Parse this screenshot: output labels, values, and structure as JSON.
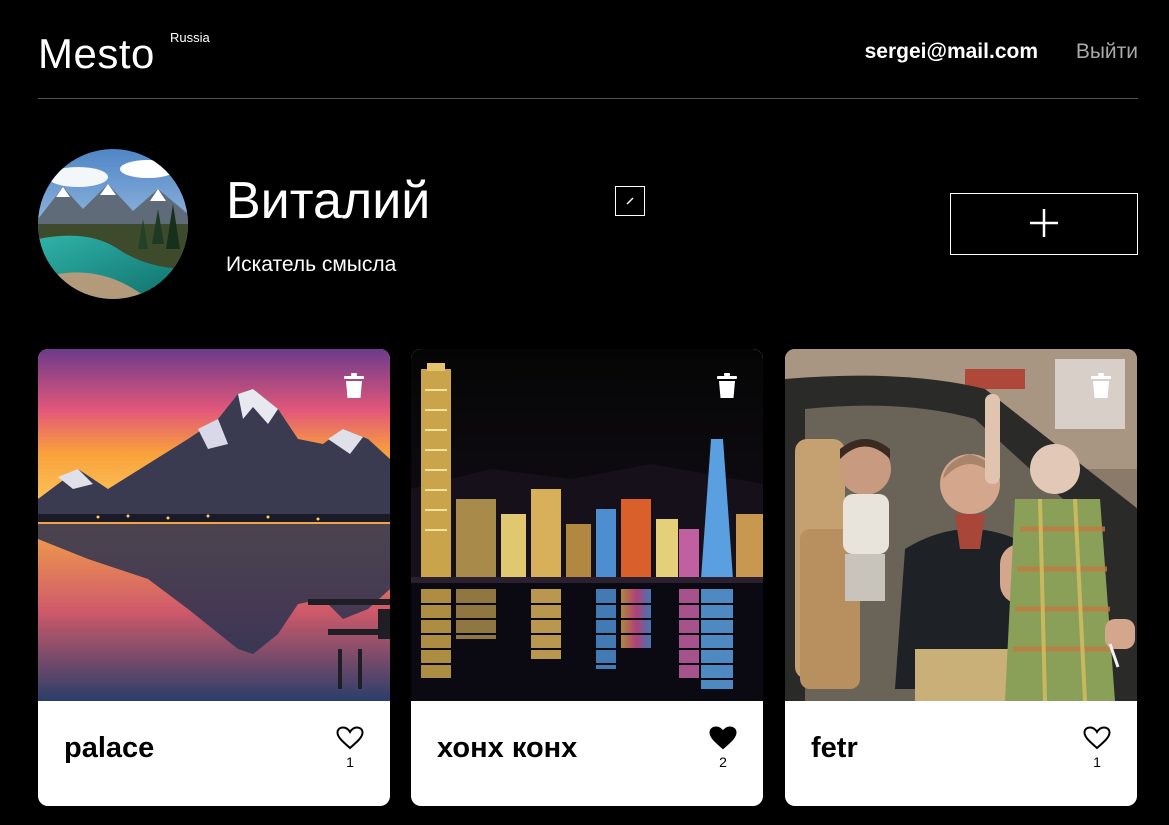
{
  "header": {
    "logo": "Mesto",
    "logo_sub": "Russia",
    "email": "sergei@mail.com",
    "logout_label": "Выйти"
  },
  "profile": {
    "name": "Виталий",
    "about": "Искатель смысла",
    "add_icon": "plus-icon",
    "edit_icon": "pencil-icon"
  },
  "cards": [
    {
      "title": "palace",
      "likes": "1",
      "liked": false,
      "image": "mountain-lake-sunset"
    },
    {
      "title": "хонх конх",
      "likes": "2",
      "liked": true,
      "image": "city-skyline-night"
    },
    {
      "title": "fetr",
      "likes": "1",
      "liked": false,
      "image": "people-in-car"
    }
  ],
  "colors": {
    "background": "#000000",
    "divider": "#545454",
    "logout": "#a9a9a9",
    "card": "#ffffff"
  }
}
